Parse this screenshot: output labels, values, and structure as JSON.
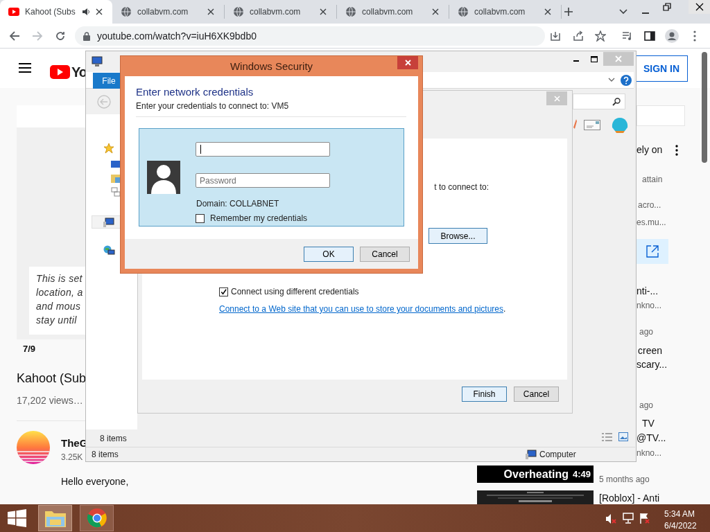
{
  "browser": {
    "tabs": [
      {
        "title": "Kahoot (Subs",
        "kind": "youtube",
        "selected": true
      },
      {
        "title": "collabvm.com",
        "kind": "globe",
        "selected": false
      },
      {
        "title": "collabvm.com",
        "kind": "globe",
        "selected": false
      },
      {
        "title": "collabvm.com",
        "kind": "globe",
        "selected": false
      },
      {
        "title": "collabvm.com",
        "kind": "globe",
        "selected": false
      }
    ],
    "url": "youtube.com/watch?v=iuH6XK9bdb0"
  },
  "youtube": {
    "logo_text": "Yo",
    "sign_in": "SIGN IN",
    "slide_lines": [
      "This is set",
      "location, a",
      "and mous",
      "stay until"
    ],
    "slide_counter": "7/9",
    "video_title": "Kahoot (Sub",
    "views": "17,202 views…",
    "channel": "TheG",
    "subscribers": "3.25K",
    "description": "Hello everyone,",
    "sidebar": [
      {
        "text": "ely on",
        "kind": "title"
      },
      {
        "text": "attain",
        "kind": "meta"
      },
      {
        "text": "acro...",
        "kind": "meta"
      },
      {
        "text": "es.mu...",
        "kind": "meta"
      },
      {
        "text": "nti-...",
        "kind": "title"
      },
      {
        "text": "nkno...",
        "kind": "meta"
      },
      {
        "text": "ago",
        "kind": "meta"
      },
      {
        "text": "creen",
        "kind": "title"
      },
      {
        "text": "scary...",
        "kind": "title"
      },
      {
        "text": "ago",
        "kind": "meta"
      },
      {
        "text": "TV",
        "kind": "title"
      },
      {
        "text": "@TV...",
        "kind": "title"
      },
      {
        "text": "nkno...",
        "kind": "meta"
      },
      {
        "text": "5 months ago",
        "kind": "meta"
      },
      {
        "text": "[Roblox] - Anti",
        "kind": "title"
      }
    ],
    "thumb_caption": "Overheating",
    "thumb_duration": "4:49"
  },
  "explorer": {
    "menu_tab": "File",
    "pane_status": "8 items",
    "status_count": "8 items",
    "status_location": "Computer"
  },
  "wizard": {
    "prompt": "t to connect to:",
    "browse": "Browse...",
    "options": [
      {
        "label": "Connect using different credentials",
        "checked": true
      }
    ],
    "link": "Connect to a Web site that you can use to store your documents and pictures",
    "link_end": ".",
    "buttons": [
      "Finish",
      "Cancel"
    ]
  },
  "security": {
    "title": "Windows Security",
    "heading": "Enter network credentials",
    "subtitle": "Enter your credentials to connect to: VM5",
    "password_placeholder": "Password",
    "domain": "Domain: COLLABNET",
    "remember": {
      "label": "Remember my credentials",
      "checked": false
    },
    "buttons": [
      "OK",
      "Cancel"
    ]
  },
  "taskbar": {
    "time": "5:34 AM",
    "date": "6/4/2022"
  }
}
